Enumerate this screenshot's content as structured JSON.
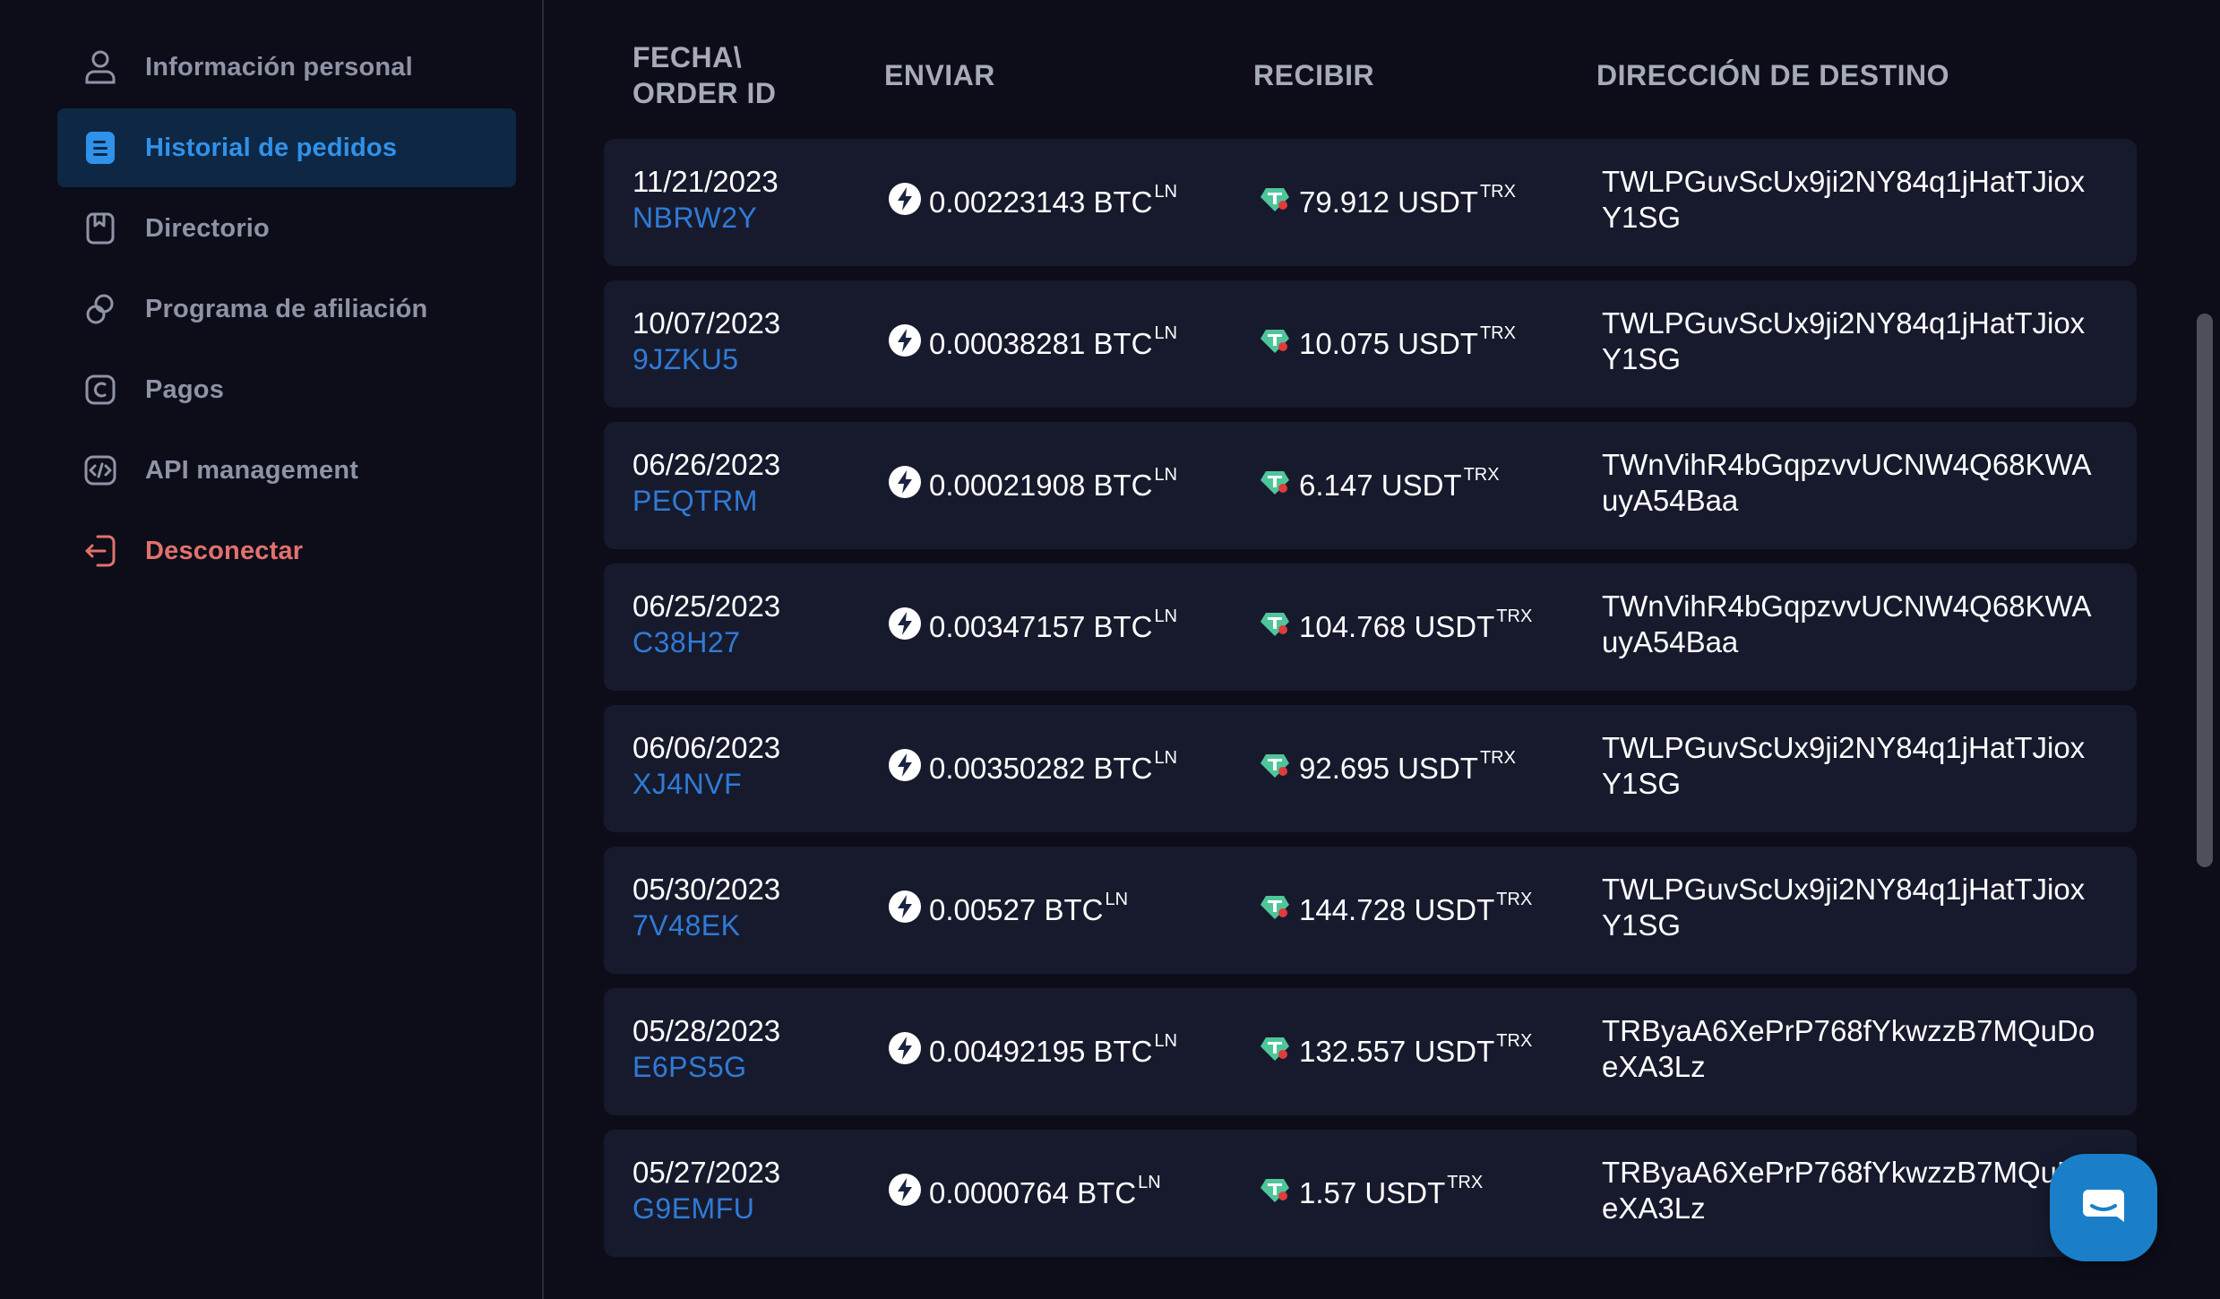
{
  "sidebar": {
    "items": [
      {
        "label": "Información personal",
        "icon": "user-icon"
      },
      {
        "label": "Historial de pedidos",
        "icon": "document-icon",
        "active": true
      },
      {
        "label": "Directorio",
        "icon": "bookmark-icon"
      },
      {
        "label": "Programa de afiliación",
        "icon": "link-icon"
      },
      {
        "label": "Pagos",
        "icon": "payment-icon"
      },
      {
        "label": "API management",
        "icon": "code-icon"
      },
      {
        "label": "Desconectar",
        "icon": "logout-icon"
      }
    ]
  },
  "table": {
    "headers": {
      "date_order": "FECHA\\\nORDER ID",
      "send": "ENVIAR",
      "receive": "RECIBIR",
      "address": "DIRECCIÓN DE DESTINO"
    },
    "send_unit": "BTC",
    "send_network": "LN",
    "receive_unit": "USDT",
    "receive_network": "TRX",
    "rows": [
      {
        "date": "11/21/2023",
        "order_id": "NBRW2Y",
        "send": "0.00223143 BTC",
        "send_sup": "LN",
        "receive": "79.912 USDT",
        "receive_sup": "TRX",
        "address": "TWLPGuvScUx9ji2NY84q1jHatTJioxY1SG"
      },
      {
        "date": "10/07/2023",
        "order_id": "9JZKU5",
        "send": "0.00038281 BTC",
        "send_sup": "LN",
        "receive": "10.075 USDT",
        "receive_sup": "TRX",
        "address": "TWLPGuvScUx9ji2NY84q1jHatTJioxY1SG"
      },
      {
        "date": "06/26/2023",
        "order_id": "PEQTRM",
        "send": "0.00021908 BTC",
        "send_sup": "LN",
        "receive": "6.147 USDT",
        "receive_sup": "TRX",
        "address": "TWnVihR4bGqpzvvUCNW4Q68KWAuyA54Baa"
      },
      {
        "date": "06/25/2023",
        "order_id": "C38H27",
        "send": "0.00347157 BTC",
        "send_sup": "LN",
        "receive": "104.768 USDT",
        "receive_sup": "TRX",
        "address": "TWnVihR4bGqpzvvUCNW4Q68KWAuyA54Baa"
      },
      {
        "date": "06/06/2023",
        "order_id": "XJ4NVF",
        "send": "0.00350282 BTC",
        "send_sup": "LN",
        "receive": "92.695 USDT",
        "receive_sup": "TRX",
        "address": "TWLPGuvScUx9ji2NY84q1jHatTJioxY1SG"
      },
      {
        "date": "05/30/2023",
        "order_id": "7V48EK",
        "send": "0.00527 BTC",
        "send_sup": "LN",
        "receive": "144.728 USDT",
        "receive_sup": "TRX",
        "address": "TWLPGuvScUx9ji2NY84q1jHatTJioxY1SG"
      },
      {
        "date": "05/28/2023",
        "order_id": "E6PS5G",
        "send": "0.00492195 BTC",
        "send_sup": "LN",
        "receive": "132.557 USDT",
        "receive_sup": "TRX",
        "address": "TRByaA6XePrP768fYkwzzB7MQuDoeXA3Lz"
      },
      {
        "date": "05/27/2023",
        "order_id": "G9EMFU",
        "send": "0.0000764 BTC",
        "send_sup": "LN",
        "receive": "1.57 USDT",
        "receive_sup": "TRX",
        "address": "TRByaA6XePrP768fYkwzzB7MQuDoeXA3Lz"
      }
    ]
  },
  "colors": {
    "background": "#0c0d19",
    "row_background": "#171a2d",
    "active_nav_bg": "#0e2744",
    "accent_blue": "#2f92ea",
    "order_id_blue": "#2f7bd6",
    "logout_red": "#e2716c",
    "muted_text": "#8e93a6",
    "header_text": "#a7abb9",
    "chat_button": "#1a7fc8"
  },
  "chat_widget": {
    "icon": "chat-bubble-icon"
  }
}
